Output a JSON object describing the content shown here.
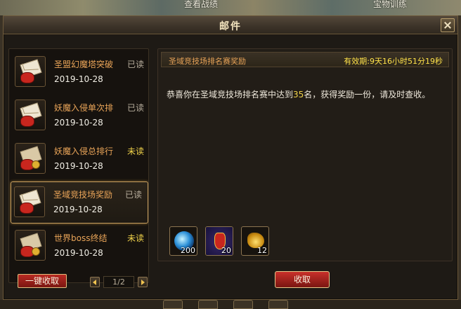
{
  "background": {
    "top_left_text": "查看战绩",
    "top_right_text": "宝物训练"
  },
  "window": {
    "title": "邮件"
  },
  "mail_list": [
    {
      "subject": "圣盟幻魔塔突破",
      "date": "2019-10-28",
      "status": "已读",
      "unread": false,
      "icon": "envelope-open-red-bag-icon"
    },
    {
      "subject": "妖魔入侵单次排",
      "date": "2019-10-28",
      "status": "已读",
      "unread": false,
      "icon": "envelope-open-red-bag-icon"
    },
    {
      "subject": "妖魔入侵总排行",
      "date": "2019-10-28",
      "status": "未读",
      "unread": true,
      "icon": "envelope-closed-red-bag-icon"
    },
    {
      "subject": "圣域竞技场奖励",
      "date": "2019-10-28",
      "status": "已读",
      "unread": false,
      "selected": true,
      "icon": "envelope-open-red-bag-icon"
    },
    {
      "subject": "世界boss终结",
      "date": "2019-10-28",
      "status": "未读",
      "unread": true,
      "icon": "envelope-closed-red-bag-icon"
    }
  ],
  "controls": {
    "claim_all_label": "一键收取",
    "page": "1/2"
  },
  "detail": {
    "title": "圣域竞技场排名赛奖励",
    "expiry": "有效期:9天16小时51分19秒",
    "body_prefix": "恭喜你在圣域竞技场排名赛中达到",
    "body_rank": "35",
    "body_suffix": "名，获得奖励一份，请及时查收。",
    "rewards": [
      {
        "icon": "blue-orb-icon",
        "quantity": "200"
      },
      {
        "icon": "red-vase-icon",
        "quantity": "20"
      },
      {
        "icon": "golden-lamp-icon",
        "quantity": "12"
      }
    ],
    "collect_label": "收取"
  },
  "colors": {
    "subject": "#e9a458",
    "read": "#b7ad9c",
    "unread": "#f0d24a",
    "expiry": "#ffe24a",
    "button_red": "#b82a22"
  }
}
